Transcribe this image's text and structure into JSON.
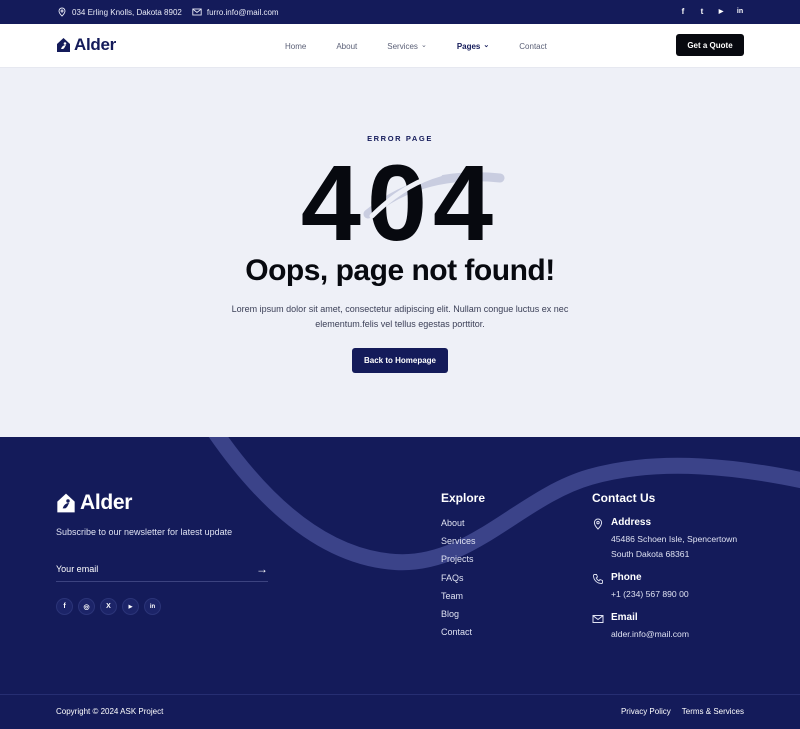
{
  "topbar": {
    "address": "034 Erling Knolls, Dakota 8902",
    "email": "furro.info@mail.com",
    "socials": [
      {
        "icon": "facebook-icon",
        "glyph": "f"
      },
      {
        "icon": "twitter-icon",
        "glyph": "t"
      },
      {
        "icon": "youtube-icon",
        "glyph": "▶"
      },
      {
        "icon": "linkedin-icon",
        "glyph": "in"
      }
    ]
  },
  "header": {
    "brand": "Alder",
    "nav": [
      {
        "label": "Home",
        "dropdown": false,
        "active": false
      },
      {
        "label": "About",
        "dropdown": false,
        "active": false
      },
      {
        "label": "Services",
        "dropdown": true,
        "active": false
      },
      {
        "label": "Pages",
        "dropdown": true,
        "active": true
      },
      {
        "label": "Contact",
        "dropdown": false,
        "active": false
      }
    ],
    "cta": "Get a Quote"
  },
  "error": {
    "eyebrow": "ERROR PAGE",
    "code": "404",
    "title": "Oops, page not found!",
    "description": "Lorem ipsum dolor sit amet, consectetur adipiscing elit. Nullam congue luctus ex nec elementum.felis vel tellus egestas porttitor.",
    "button": "Back to Homepage"
  },
  "footer": {
    "brand": "Alder",
    "subscribe_text": "Subscribe to our newsletter for latest update",
    "email_placeholder": "Your email",
    "socials": [
      {
        "icon": "facebook-icon",
        "glyph": "f"
      },
      {
        "icon": "instagram-icon",
        "glyph": "◎"
      },
      {
        "icon": "x-icon",
        "glyph": "X"
      },
      {
        "icon": "youtube-icon",
        "glyph": "▶"
      },
      {
        "icon": "linkedin-icon",
        "glyph": "in"
      }
    ],
    "explore_title": "Explore",
    "explore_links": [
      "About",
      "Services",
      "Projects",
      "FAQs",
      "Team",
      "Blog",
      "Contact"
    ],
    "contact_title": "Contact Us",
    "contact": {
      "address_label": "Address",
      "address_line1": "45486 Schoen Isle, Spencertown",
      "address_line2": "South Dakota 68361",
      "phone_label": "Phone",
      "phone": "+1 (234) 567 890 00",
      "email_label": "Email",
      "email": "alder.info@mail.com"
    },
    "copyright": "Copyright © 2024 ASK Project",
    "legal": [
      "Privacy Policy",
      "Terms & Services"
    ]
  },
  "colors": {
    "navy": "#141b5a",
    "black": "#07090f",
    "page_bg": "#eef0f7",
    "wave": "#3b4389"
  }
}
